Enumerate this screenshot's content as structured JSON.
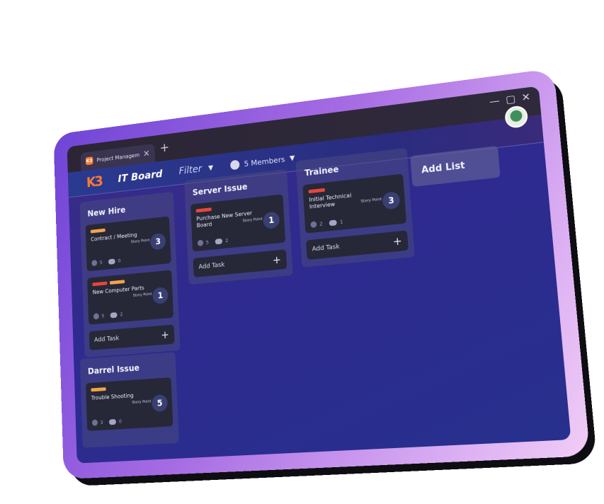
{
  "tab": {
    "title": "Project Managemen",
    "logo": "K3"
  },
  "window_controls": [
    "—",
    "▢",
    "✕"
  ],
  "header": {
    "logo": "K3",
    "board_title": "IT Board",
    "filter_label": "Filter",
    "members_label": "5 Members"
  },
  "lists": [
    {
      "title": "New Hire",
      "cards": [
        {
          "title": "Contract / Meeting",
          "labels": [
            "#f3a24a"
          ],
          "story_point_label": "Story Point",
          "story_points": "3",
          "members": "5",
          "comments": "0"
        },
        {
          "title": "New Computer Parts",
          "labels": [
            "#e8463b",
            "#f3a24a"
          ],
          "story_point_label": "Story Point",
          "story_points": "1",
          "members": "5",
          "comments": "2"
        }
      ],
      "add_task": "Add Task"
    },
    {
      "title": "Server Issue",
      "cards": [
        {
          "title": "Purchase New Server Board",
          "labels": [
            "#e8463b"
          ],
          "story_point_label": "Story Point",
          "story_points": "1",
          "members": "5",
          "comments": "2"
        }
      ],
      "add_task": "Add Task"
    },
    {
      "title": "Trainee",
      "cards": [
        {
          "title": "Initial Technical Interview",
          "labels": [
            "#e8463b"
          ],
          "story_point_label": "Story Point",
          "story_points": "3",
          "members": "2",
          "comments": "1"
        }
      ],
      "add_task": "Add Task"
    },
    {
      "title": "Darrel Issue",
      "cards": [
        {
          "title": "Trouble Shooting",
          "labels": [
            "#f3a24a"
          ],
          "story_point_label": "Story Point",
          "story_points": "5",
          "members": "3",
          "comments": "0"
        }
      ],
      "add_task": "Add Task"
    }
  ],
  "add_list": "Add List",
  "colors": {
    "accent_orange": "#ff7a2f",
    "label_red": "#e8463b",
    "label_orange": "#f3a24a"
  }
}
